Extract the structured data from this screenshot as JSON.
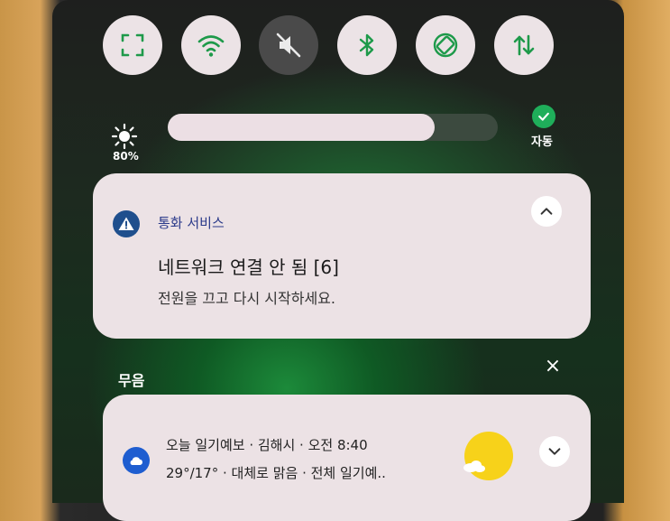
{
  "quick_settings": [
    {
      "name": "screenshot-icon",
      "state": "on"
    },
    {
      "name": "wifi-icon",
      "state": "on"
    },
    {
      "name": "sound-muted-icon",
      "state": "off"
    },
    {
      "name": "bluetooth-icon",
      "state": "on"
    },
    {
      "name": "auto-rotate-icon",
      "state": "on"
    },
    {
      "name": "mobile-data-icon",
      "state": "on"
    }
  ],
  "brightness": {
    "percent_label": "80%",
    "level": 0.81,
    "auto_label": "자동"
  },
  "notification_call": {
    "app_name": "통화 서비스",
    "title": "네트워크 연결 안 됨 [6]",
    "body": "전원을 끄고 다시 시작하세요."
  },
  "silent_section": {
    "label": "무음",
    "close_symbol": "×"
  },
  "notification_weather": {
    "line1": "오늘 일기예보 · 김해시 · 오전 8:40",
    "line2": "29°/17° · 대체로 맑음 · 전체 일기예.."
  },
  "colors": {
    "card": "#ece2e5",
    "accent_green": "#1fae5a",
    "warning_blue": "#1f4f8d",
    "weather_blue": "#1e5dd0"
  }
}
